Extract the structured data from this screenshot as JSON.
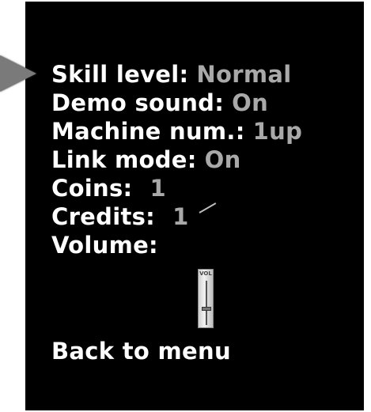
{
  "menu": {
    "items": [
      {
        "label": "Skill level:",
        "value": "Normal"
      },
      {
        "label": "Demo sound:",
        "value": "On"
      },
      {
        "label": "Machine num.:",
        "value": "1up"
      },
      {
        "label": "Link mode:",
        "value": "On"
      },
      {
        "label": "Coins:",
        "value": "1"
      },
      {
        "label": "Credits:",
        "value": "1"
      },
      {
        "label": "Volume:",
        "value": ""
      }
    ],
    "back_label": "Back to menu"
  },
  "volume": {
    "slider_label": "VOL",
    "level": 0.35
  },
  "colors": {
    "background": "#000000",
    "label": "#ffffff",
    "value": "#a9a9a9",
    "cursor": "#7a7a7a"
  },
  "icons": {
    "cursor": "selection-arrow-icon"
  }
}
